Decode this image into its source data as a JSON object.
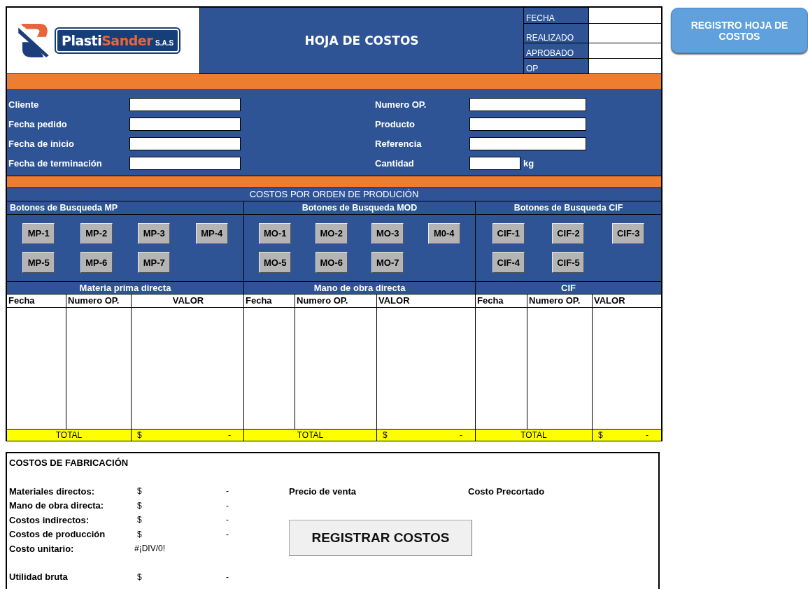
{
  "header": {
    "logo": {
      "name_main": "Plasti",
      "name_accent": "Sander",
      "suffix": "S.A.S"
    },
    "title": "HOJA DE COSTOS",
    "meta_fields": [
      {
        "label": "FECHA"
      },
      {
        "label": "REALIZADO"
      },
      {
        "label": "APROBADO"
      },
      {
        "label": "OP"
      }
    ]
  },
  "register_sheet_button": "REGISTRO HOJA DE COSTOS",
  "form": {
    "left_fields": [
      {
        "label": "Cliente"
      },
      {
        "label": "Fecha pedido"
      },
      {
        "label": "Fecha de inicio"
      },
      {
        "label": "Fecha de terminación"
      }
    ],
    "right_fields": [
      {
        "label": "Numero OP."
      },
      {
        "label": "Producto"
      },
      {
        "label": "Referencia"
      },
      {
        "label": "Cantidad",
        "unit": "kg"
      }
    ]
  },
  "costs": {
    "title": "COSTOS POR ORDEN DE PRODUCIÓN",
    "sections": [
      {
        "search_title": "Botones de Busqueda MP",
        "buttons": [
          "MP-1",
          "MP-2",
          "MP-3",
          "MP-4",
          "MP-5",
          "MP-6",
          "MP-7"
        ],
        "table_title": "Materia prima directa",
        "columns": [
          "Fecha",
          "Numero OP.",
          "VALOR"
        ],
        "total_label": "TOTAL",
        "total_currency": "$",
        "total_value": "-"
      },
      {
        "search_title": "Botones de Busqueda MOD",
        "buttons": [
          "MO-1",
          "MO-2",
          "MO-3",
          "M0-4",
          "MO-5",
          "MO-6",
          "MO-7"
        ],
        "table_title": "Mano de obra directa",
        "columns": [
          "Fecha",
          "Numero OP.",
          "VALOR"
        ],
        "total_label": "TOTAL",
        "total_currency": "$",
        "total_value": "-"
      },
      {
        "search_title": "Botones de Busqueda CIF",
        "buttons": [
          "CIF-1",
          "CIF-2",
          "CIF-3",
          "CIF-4",
          "CIF-5"
        ],
        "table_title": "CIF",
        "columns": [
          "Fecha",
          "Numero OP.",
          "VALOR"
        ],
        "total_label": "TOTAL",
        "total_currency": "$",
        "total_value": "-"
      }
    ]
  },
  "summary": {
    "title": "COSTOS DE FABRICACIÓN",
    "rows": [
      {
        "label": "Materiales directos:",
        "currency": "$",
        "value": "-"
      },
      {
        "label": "Mano de obra directa:",
        "currency": "$",
        "value": "-"
      },
      {
        "label": "Costos indirectos:",
        "currency": "$",
        "value": "-"
      },
      {
        "label": "Costos de producción",
        "currency": "$",
        "value": "-"
      },
      {
        "label": "Costo unitario:",
        "value": "#¡DIV/0!"
      },
      {
        "label": "Utilidad bruta",
        "currency": "$",
        "value": "-"
      }
    ],
    "sale_price_label": "Precio de venta",
    "cost_label": "Costo Precortado",
    "register_button": "REGISTRAR COSTOS"
  }
}
